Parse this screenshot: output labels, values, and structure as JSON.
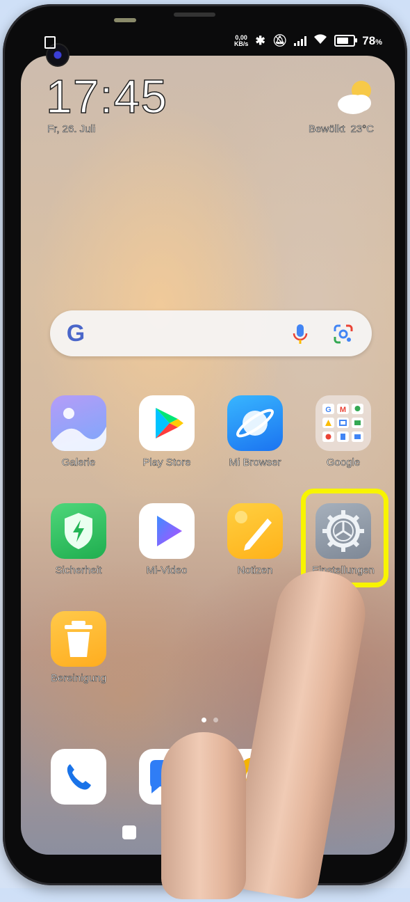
{
  "status_bar": {
    "speed_value": "0,00",
    "speed_unit": "KB/s",
    "battery_percent": "78",
    "battery_level": 0.78,
    "battery_suffix": "%"
  },
  "lockscreen_widget": {
    "time": "17:45",
    "date": "Fr, 26. Juli",
    "weather_condition": "Bewölkt",
    "temperature": "23°C",
    "weather_icon": "partly-cloudy-icon"
  },
  "search_bar": {
    "logo": "G",
    "mic_icon": "microphone-icon",
    "lens_icon": "google-lens-icon"
  },
  "apps": [
    {
      "label": "Galerie",
      "icon": "gallery-icon"
    },
    {
      "label": "Play Store",
      "icon": "play-store-icon"
    },
    {
      "label": "Mi Browser",
      "icon": "mi-browser-icon"
    },
    {
      "label": "Google",
      "icon": "google-folder-icon"
    },
    {
      "label": "Sicherheit",
      "icon": "security-shield-icon"
    },
    {
      "label": "Mi-Video",
      "icon": "mi-video-icon"
    },
    {
      "label": "Notizen",
      "icon": "notes-icon"
    },
    {
      "label": "Einstellungen",
      "icon": "settings-gear-icon"
    },
    {
      "label": "Bereinigung",
      "icon": "cleaner-trash-icon"
    }
  ],
  "dock": [
    {
      "icon": "phone-icon"
    },
    {
      "icon": "messages-icon"
    },
    {
      "icon": "chrome-icon"
    }
  ],
  "colors": {
    "highlight": "#f8f400",
    "shield": "#22b455",
    "notes": "#ffbb22",
    "browser": "#2a8df8"
  }
}
